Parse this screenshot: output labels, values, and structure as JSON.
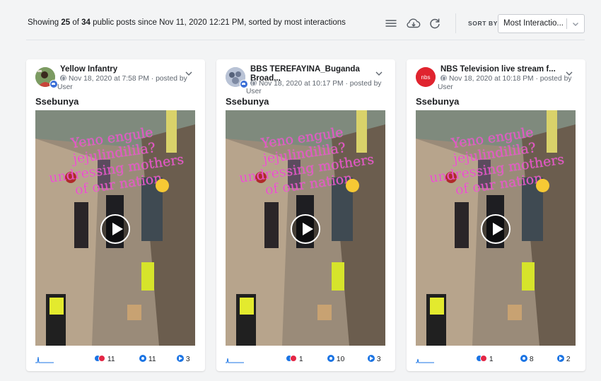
{
  "header": {
    "summary_prefix": "Showing",
    "shown_count": "25",
    "summary_of": "of",
    "total_count": "34",
    "summary_suffix": "public posts since Nov 11, 2020 12:21 PM, sorted by most interactions",
    "sort_by_label": "SORT BY",
    "sort_value": "Most Interactio...",
    "icons": [
      "list-view-icon",
      "cloud-download-icon",
      "refresh-icon",
      "chevron-down-icon"
    ]
  },
  "posts": [
    {
      "page_name": "Yellow Infantry",
      "date": "Nov 18, 2020 at 7:58 PM",
      "posted_by": "posted by",
      "user_label": "User",
      "message": "Ssebunya",
      "overlay_lines": [
        "Yeno engule",
        "jejulindilila?",
        "undressing mothers",
        "of our nation"
      ],
      "reactions": "11",
      "comments": "11",
      "shares": "3",
      "avatar_color": "#6d8f4e"
    },
    {
      "page_name": "BBS TEREFAYINA_Buganda Broad...",
      "date": "Nov 18, 2020 at 10:17 PM",
      "posted_by": "posted by",
      "user_label": "User",
      "message": "Ssebunya",
      "overlay_lines": [
        "Yeno engule",
        "jejulindilila?",
        "undressing mothers",
        "of our nation"
      ],
      "reactions": "1",
      "comments": "10",
      "shares": "3",
      "avatar_color": "#9aa7bf"
    },
    {
      "page_name": "NBS Television live stream f...",
      "date": "Nov 18, 2020 at 10:18 PM",
      "posted_by": "posted by",
      "user_label": "User",
      "message": "Ssebunya",
      "overlay_lines": [
        "Yeno engule",
        "jejulindilila?",
        "undressing mothers",
        "of our nation"
      ],
      "reactions": "1",
      "comments": "8",
      "shares": "2",
      "avatar_color": "#e0242f",
      "avatar_text": "nbs"
    }
  ],
  "colors": {
    "accent": "#1b74e4",
    "overlay_text": "#e84fc9",
    "background": "#f3f4f5"
  }
}
